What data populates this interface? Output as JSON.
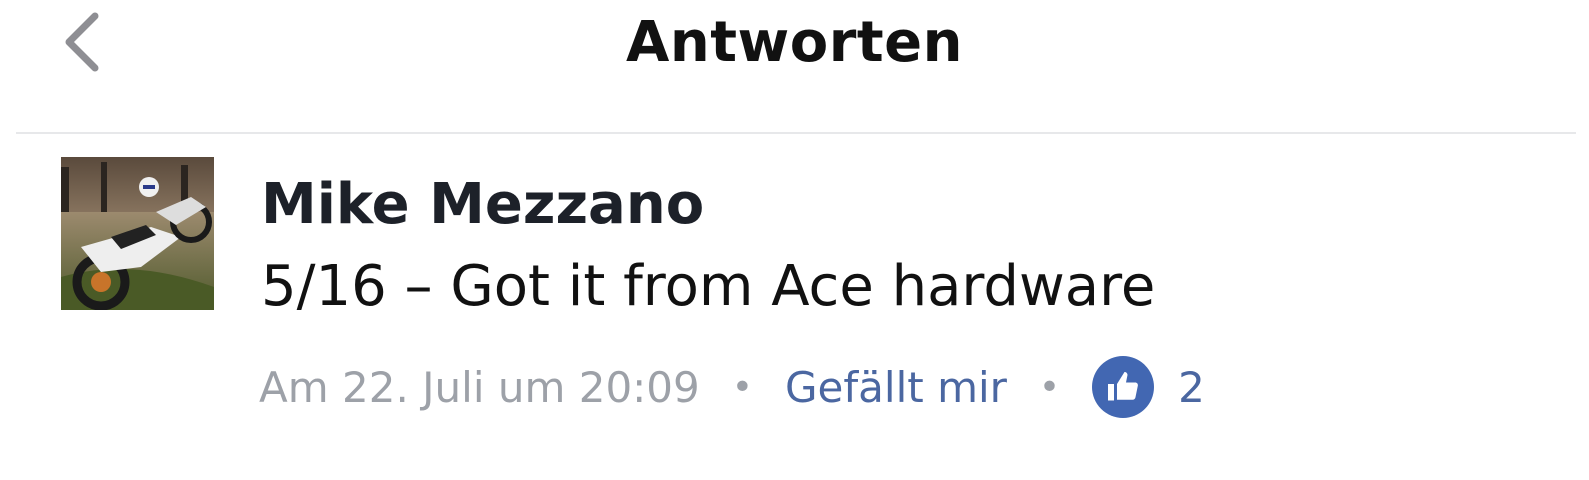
{
  "header": {
    "back_icon": "chevron-left-icon",
    "title": "Antworten"
  },
  "comment": {
    "avatar_icon": "profile-photo-motorbikes",
    "author": "Mike Mezzano",
    "text": "5/16 – Got it from Ace hardware",
    "timestamp": "Am 22. Juli um 20:09",
    "separator": "•",
    "like_label": "Gefällt mir",
    "like_icon": "thumbs-up-icon",
    "like_count": "2"
  },
  "colors": {
    "like_blue": "#4267b2",
    "link_blue": "#4b67a1",
    "muted_gray": "#9da1a8",
    "divider": "#e7e8ea"
  }
}
